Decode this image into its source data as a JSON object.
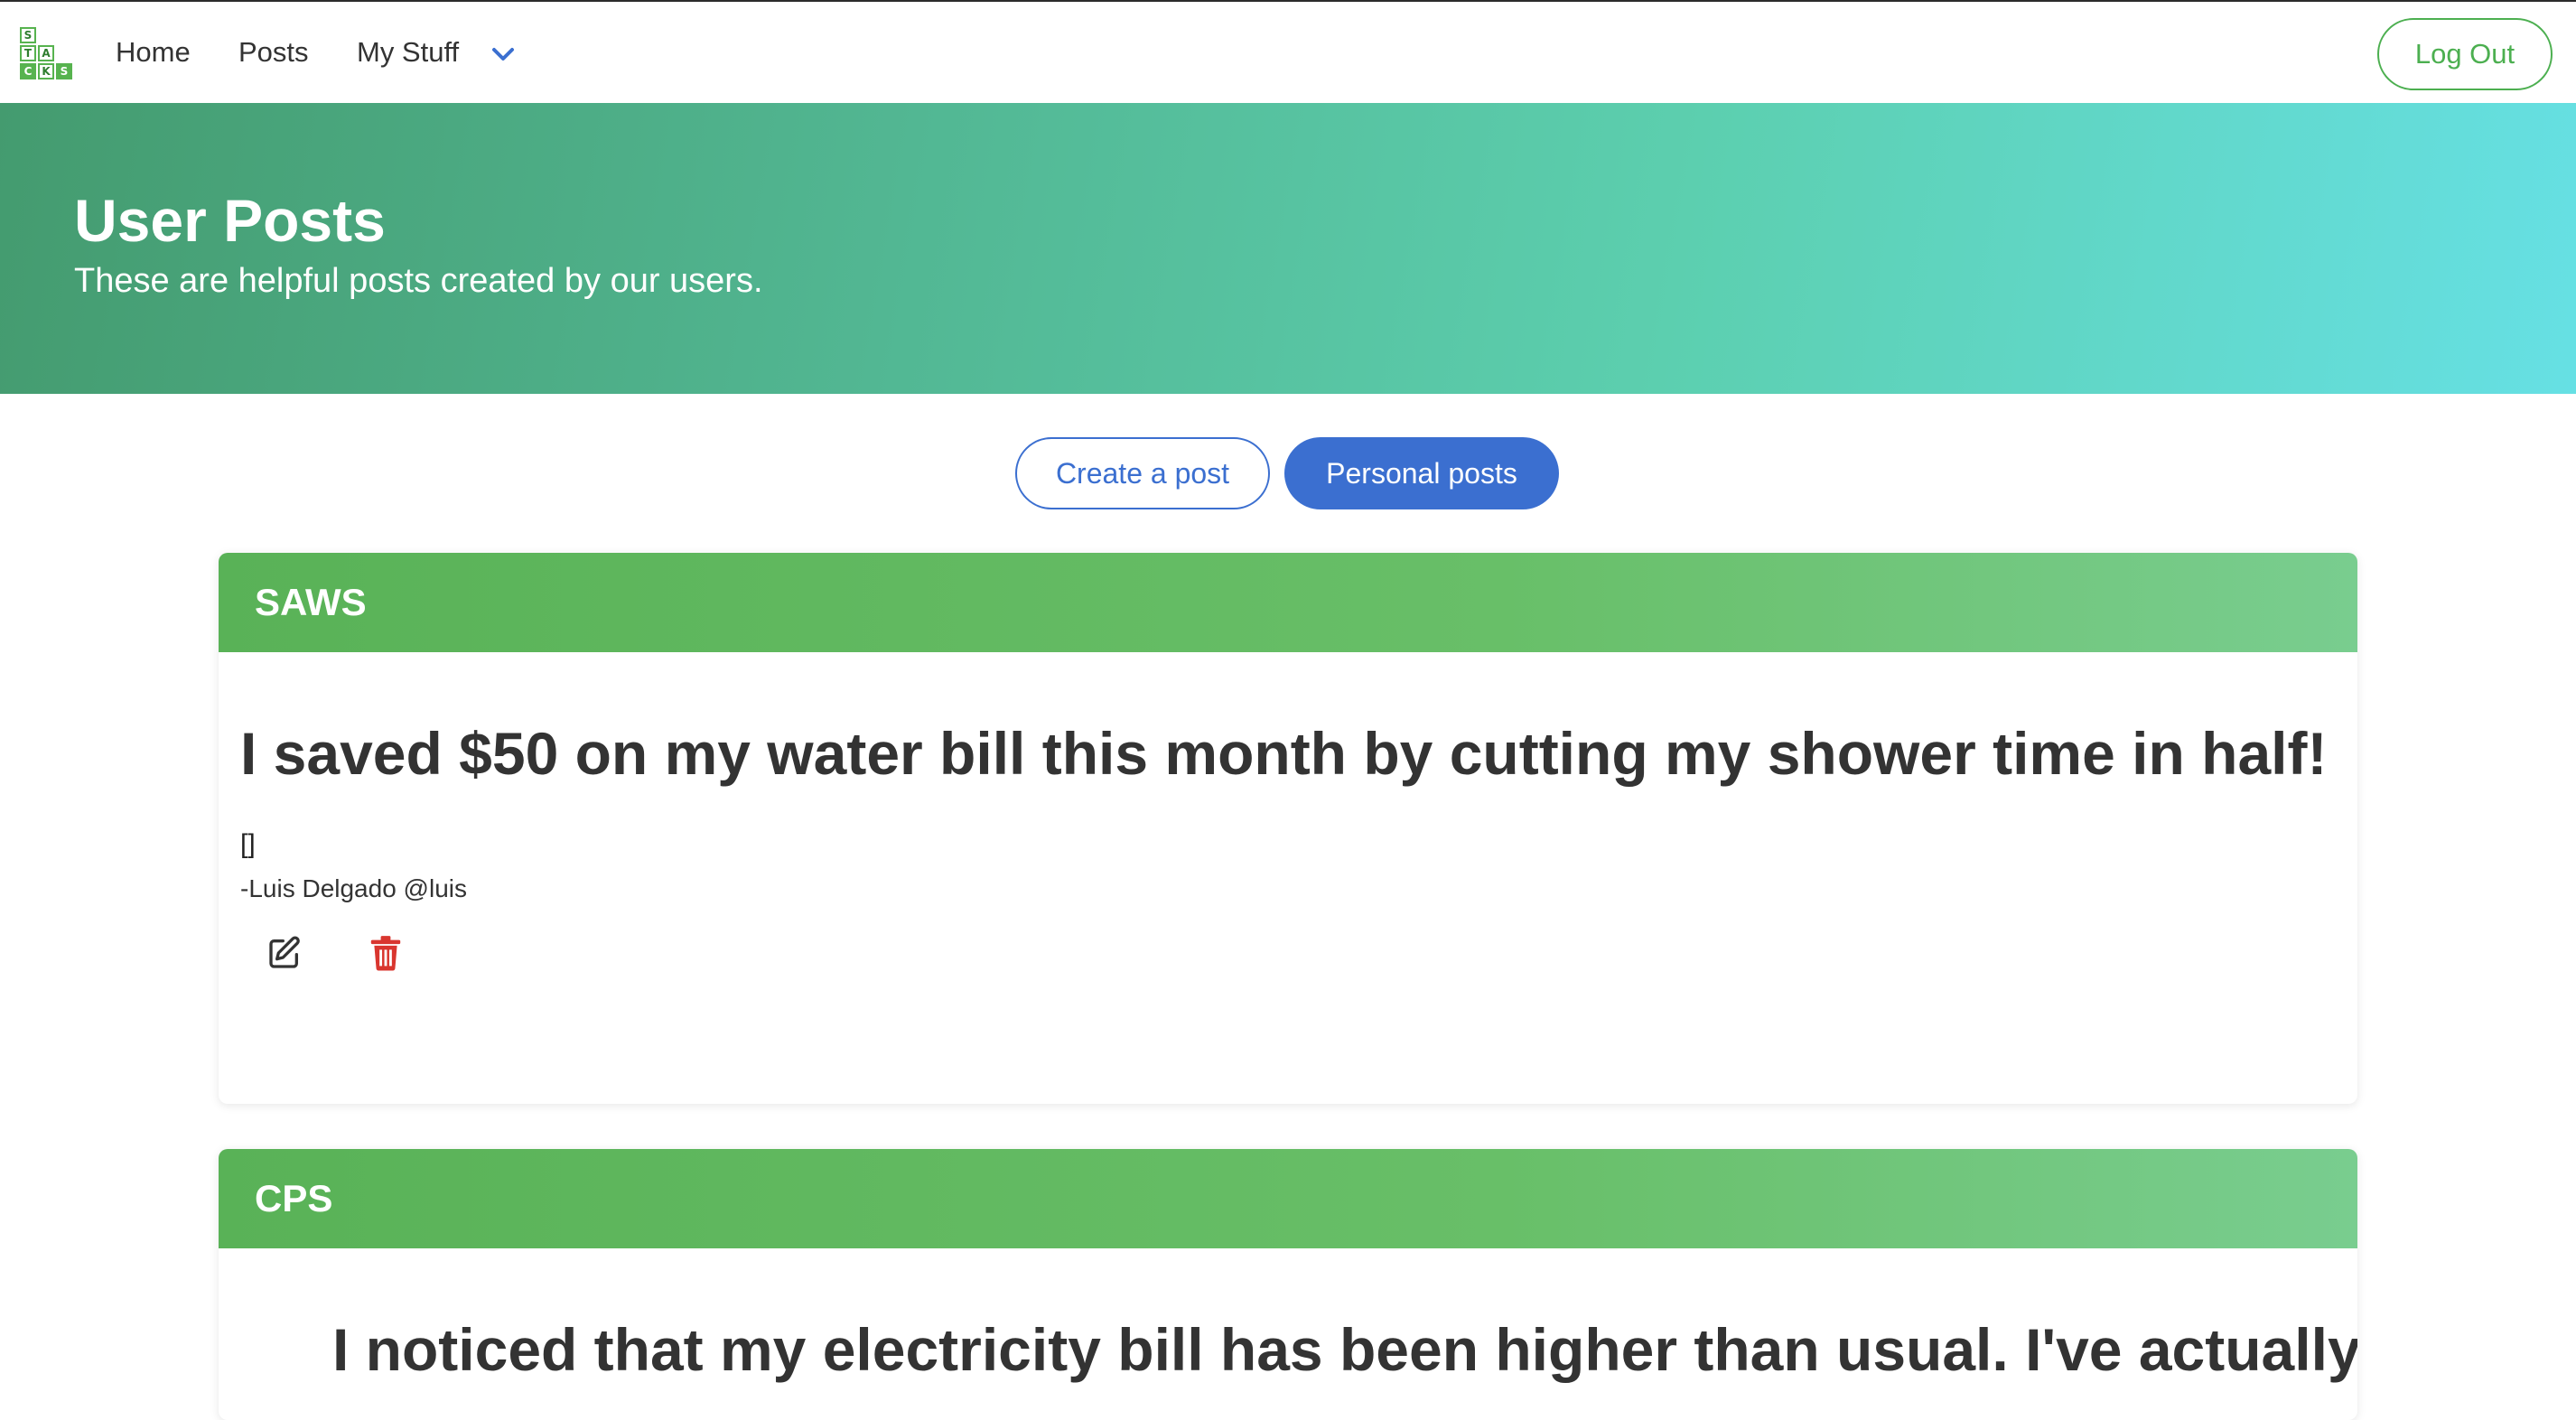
{
  "brand": {
    "logo_letters": [
      "S",
      "",
      "",
      "T",
      "A",
      "",
      "C",
      "K",
      "S"
    ]
  },
  "nav": {
    "home": "Home",
    "posts": "Posts",
    "my_stuff": "My Stuff",
    "logout": "Log Out"
  },
  "hero": {
    "title": "User Posts",
    "subtitle": "These are helpful posts created by our users."
  },
  "actions": {
    "create": "Create a post",
    "personal": "Personal posts"
  },
  "posts": [
    {
      "category": "SAWS",
      "title": "I saved $50 on my water bill this month by cutting my shower time in half!",
      "tags": "[]",
      "author": "-Luis Delgado @luis"
    },
    {
      "category": "CPS",
      "title": "I noticed that my electricity bill has been higher than usual. I've actually"
    }
  ],
  "icons": {
    "chevron": "chevron-down-icon",
    "edit": "edit-icon",
    "delete": "trash-icon"
  },
  "colors": {
    "primary_blue": "#3b6fd0",
    "brand_green": "#4caf50",
    "delete_red": "#d9362f",
    "hero_gradient_start": "#449b6f",
    "hero_gradient_end": "#66e0e4"
  }
}
